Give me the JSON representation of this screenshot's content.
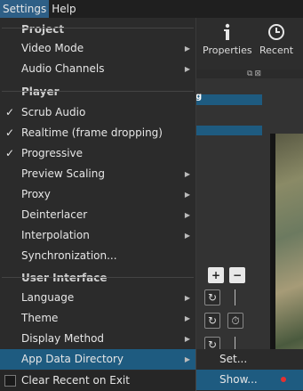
{
  "menubar": {
    "settings": "Settings",
    "help": "Help"
  },
  "toolbar": {
    "properties": "Properties",
    "recent": "Recent"
  },
  "menu": {
    "project_header": "Project",
    "video_mode": "Video Mode",
    "audio_channels": "Audio Channels",
    "player_header": "Player",
    "scrub_audio": "Scrub Audio",
    "realtime": "Realtime (frame dropping)",
    "progressive": "Progressive",
    "preview_scaling": "Preview Scaling",
    "proxy": "Proxy",
    "deinterlacer": "Deinterlacer",
    "interpolation": "Interpolation",
    "synchronization": "Synchronization...",
    "ui_header": "User Interface",
    "language": "Language",
    "theme": "Theme",
    "display_method": "Display Method",
    "app_data_directory": "App Data Directory",
    "clear_recent": "Clear Recent on Exit",
    "check_glyph": "✓",
    "arrow_glyph": "▶"
  },
  "submenu": {
    "set": "Set...",
    "show": "Show..."
  },
  "icons": [
    "info-icon",
    "clock-icon",
    "float-icon",
    "close-icon",
    "plus-icon",
    "minus-icon",
    "loop-icon",
    "timer-icon"
  ],
  "colors": {
    "highlight": "#1e5b80",
    "menubar_active": "#2e5f86",
    "background": "#2b2b2b",
    "red_dot": "#e53030"
  }
}
